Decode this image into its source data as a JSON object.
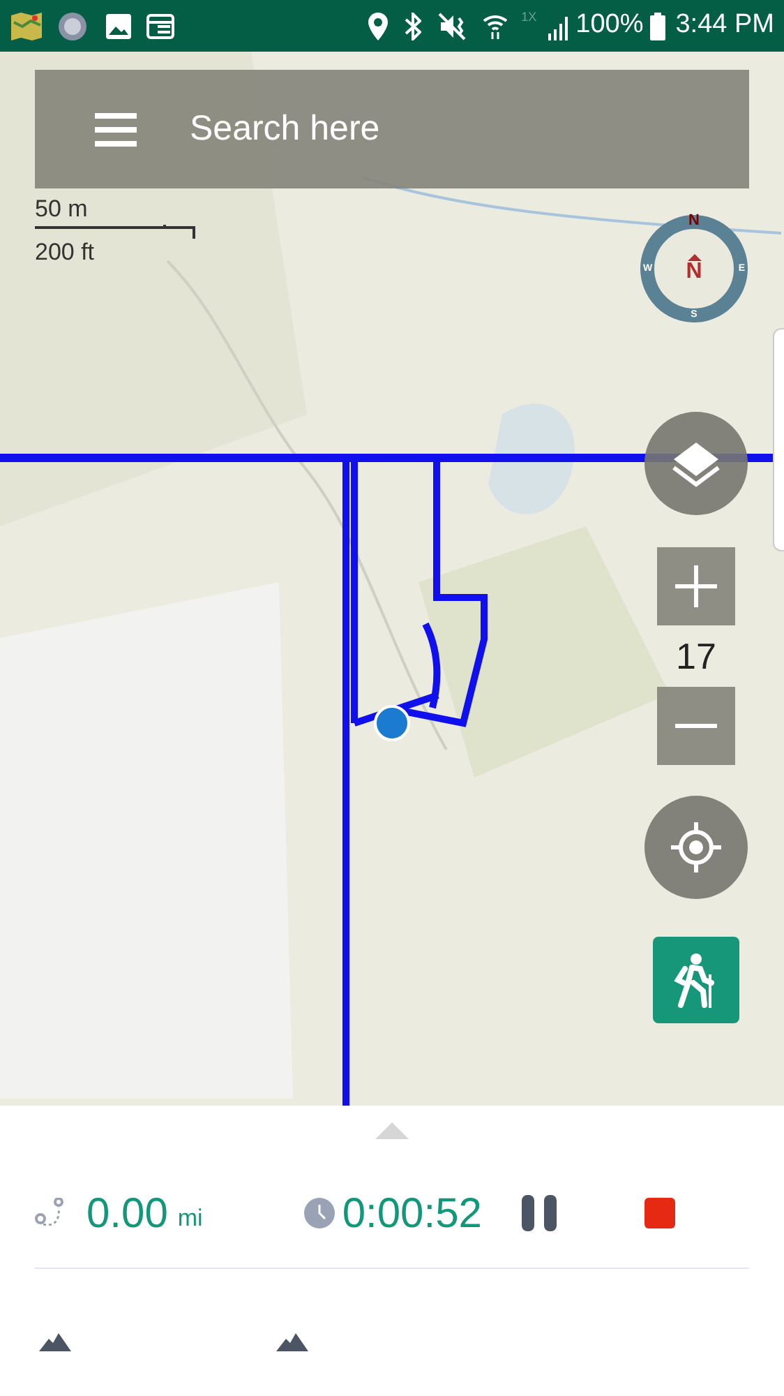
{
  "status_bar": {
    "network_type": "1X",
    "battery": "100%",
    "time": "3:44 PM"
  },
  "search": {
    "placeholder": "Search here"
  },
  "map": {
    "scale": {
      "metric": "50 m",
      "imperial": "200 ft"
    },
    "compass": {
      "north": "N",
      "east": "E",
      "south": "S",
      "west": "W",
      "heading": "N"
    },
    "zoom_level": "17"
  },
  "tracking": {
    "distance": "0.00",
    "distance_unit": "mi",
    "duration": "0:00:52",
    "paused": false
  }
}
